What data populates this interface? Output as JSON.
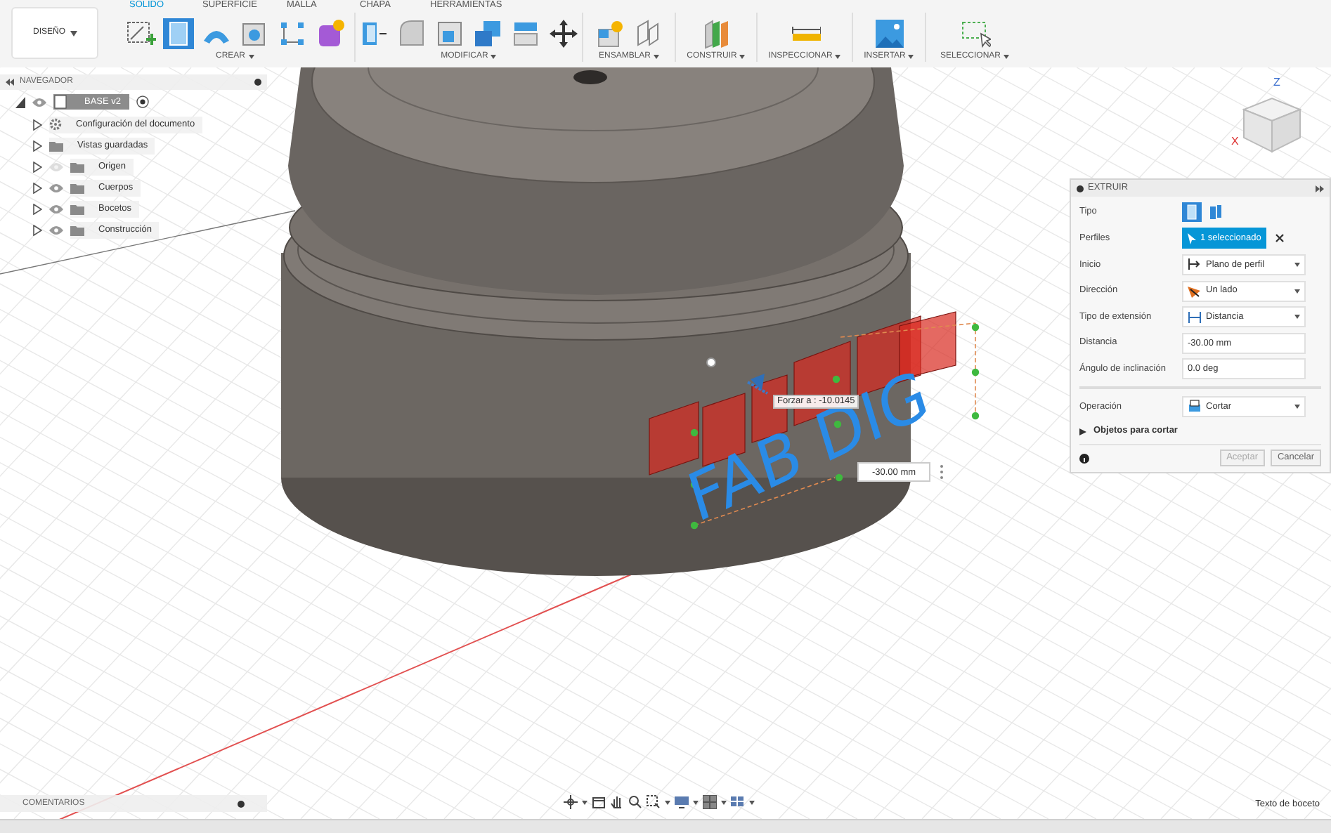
{
  "workspace": {
    "label": "DISEÑO"
  },
  "tabs": [
    {
      "label": "SOLIDO",
      "selected": true
    },
    {
      "label": "SUPERFICIE",
      "selected": false
    },
    {
      "label": "MALLA",
      "selected": false
    },
    {
      "label": "CHAPA",
      "selected": false
    },
    {
      "label": "HERRAMIENTAS",
      "selected": false
    }
  ],
  "tool_groups": [
    {
      "label": "CREAR"
    },
    {
      "label": "MODIFICAR"
    },
    {
      "label": "ENSAMBLAR"
    },
    {
      "label": "CONSTRUIR"
    },
    {
      "label": "INSPECCIONAR"
    },
    {
      "label": "INSERTAR"
    },
    {
      "label": "SELECCIONAR"
    }
  ],
  "navigator": {
    "title": "NAVEGADOR",
    "root": {
      "label": "BASE v2",
      "expanded": true,
      "children": [
        {
          "label": "Configuración del documento",
          "kind": "settings",
          "expanded": false
        },
        {
          "label": "Vistas guardadas",
          "kind": "folder",
          "expanded": false
        },
        {
          "label": "Origen",
          "kind": "folder",
          "expanded": false,
          "visible": false
        },
        {
          "label": "Cuerpos",
          "kind": "folder",
          "expanded": false,
          "visible": true
        },
        {
          "label": "Bocetos",
          "kind": "folder",
          "expanded": false,
          "visible": true
        },
        {
          "label": "Construcción",
          "kind": "folder",
          "expanded": false,
          "visible": true
        }
      ]
    }
  },
  "viewport": {
    "viewcube": {
      "axis_z": "Z",
      "axis_x": "X"
    },
    "sketch_text": "FAB DIG",
    "snap_tooltip": "Forzar a : -10.0145",
    "distance_input": "-30.00 mm"
  },
  "extrude_panel": {
    "title": "EXTRUIR",
    "rows": [
      {
        "kind": "type",
        "label": "Tipo"
      },
      {
        "kind": "selection",
        "label": "Perfiles",
        "value": "1 seleccionado"
      },
      {
        "kind": "dropdown",
        "label": "Inicio",
        "value": "Plano de perfil"
      },
      {
        "kind": "dropdown",
        "label": "Dirección",
        "value": "Un lado"
      },
      {
        "kind": "dropdown",
        "label": "Tipo de extensión",
        "value": "Distancia"
      },
      {
        "kind": "input",
        "label": "Distancia",
        "value": "-30.00 mm"
      },
      {
        "kind": "input",
        "label": "Ángulo de inclinación",
        "value": "0.0 deg"
      }
    ],
    "operation": {
      "label": "Operación",
      "value": "Cortar"
    },
    "expander": {
      "label": "Objetos para cortar",
      "expanded": false
    },
    "buttons": [
      {
        "label": "Aceptar",
        "disabled": true
      },
      {
        "label": "Cancelar",
        "disabled": false
      }
    ]
  },
  "comments_panel": {
    "title": "COMENTARIOS"
  },
  "status": "Texto de boceto"
}
